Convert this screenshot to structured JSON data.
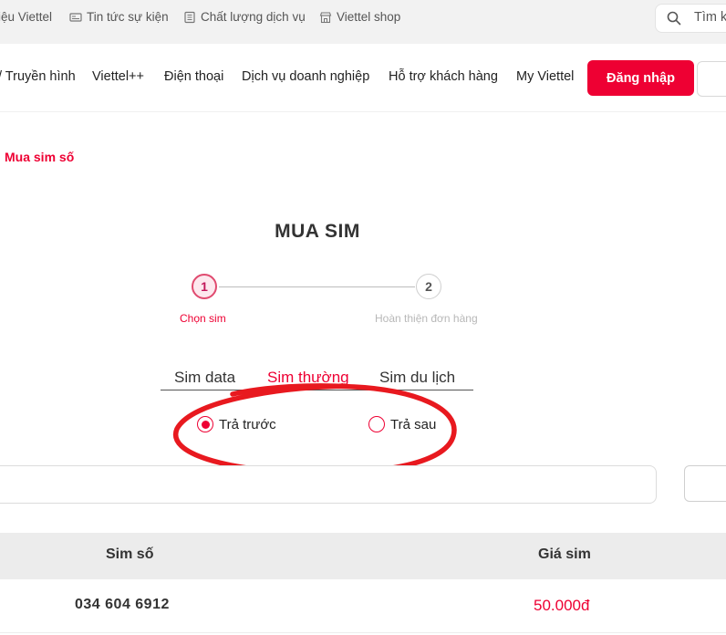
{
  "topbar": {
    "links": [
      "iệu Viettel",
      "Tin tức sự kiện",
      "Chất lượng dịch vụ",
      "Viettel shop"
    ],
    "search_text": "Tìm k"
  },
  "nav": {
    "items": [
      "/ Truyền hình",
      "Viettel++",
      "Điện thoại",
      "Dịch vụ doanh nghiệp",
      "Hỗ trợ khách hàng",
      "My Viettel"
    ],
    "login_label": "Đăng nhập"
  },
  "breadcrumb": "Mua sim số",
  "page_title": "MUA SIM",
  "steps": [
    {
      "number": "1",
      "label": "Chọn sim",
      "active": true
    },
    {
      "number": "2",
      "label": "Hoàn thiện đơn hàng",
      "active": false
    }
  ],
  "tabs": [
    {
      "label": "Sim data",
      "active": false
    },
    {
      "label": "Sim thường",
      "active": true
    },
    {
      "label": "Sim du lịch",
      "active": false
    }
  ],
  "radio_options": [
    {
      "label": "Trả trước",
      "selected": true
    },
    {
      "label": "Trả sau",
      "selected": false
    }
  ],
  "table": {
    "headers": [
      "Sim số",
      "Giá sim"
    ],
    "rows": [
      {
        "number": "034 604 6912",
        "price": "50.000đ"
      }
    ]
  },
  "colors": {
    "accent": "#ee0033",
    "annotation": "#e8191f"
  }
}
